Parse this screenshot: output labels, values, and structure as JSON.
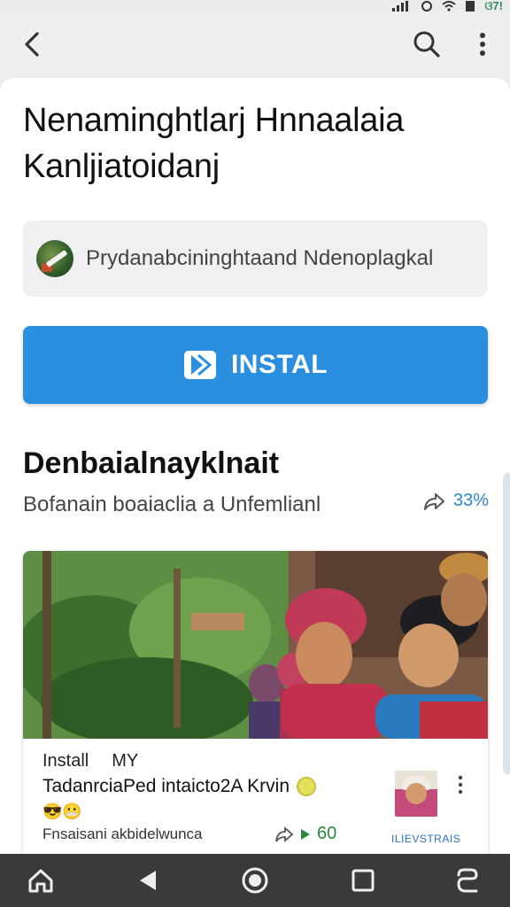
{
  "status_bar": {
    "battery_text": "ଓ7!"
  },
  "header": {
    "icons": [
      "back-arrow-icon",
      "search-icon",
      "more-vert-icon"
    ]
  },
  "app": {
    "title": "Nenaminghtlarj Hnnaalaia Kanljiatoidanj",
    "developer": "Prydanabcininghtaand Ndenoplagkal",
    "install_label": "INSTAL"
  },
  "section": {
    "title": "Denbaialnayklnait",
    "subtitle": "Bofanain boaiaclia a Unfemlianl",
    "share_value": "33%"
  },
  "card": {
    "line1_left": "Install",
    "line1_right": "MY",
    "title": "TadanrciaPed intaicto2A Krvin",
    "emojis": "😎😬",
    "caption": "Fnsaisani a​kbidelwunca",
    "stat_value": "60",
    "thumb_label": "ILIEVSTRAIS"
  },
  "colors": {
    "accent": "#2b8fe0",
    "nav_bar": "#3a3a3a",
    "stat_green": "#2a8a3a"
  }
}
